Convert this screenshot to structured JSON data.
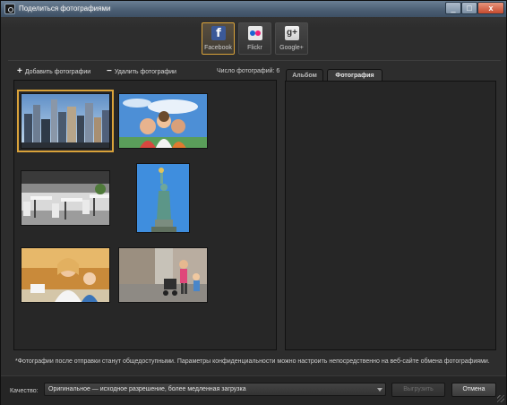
{
  "window": {
    "title": "Поделиться фотографиями",
    "controls": {
      "minimize": "_",
      "maximize": "□",
      "close": "x"
    }
  },
  "services": [
    {
      "name": "Facebook",
      "icon": "facebook-icon",
      "active": true,
      "logo_text": "f"
    },
    {
      "name": "Flickr",
      "icon": "flickr-icon",
      "active": false,
      "logo_text": ""
    },
    {
      "name": "Google+",
      "icon": "google-plus-icon",
      "active": false,
      "logo_text": "g+"
    }
  ],
  "actions": {
    "add_label": "Добавить фотографии",
    "remove_label": "Удалить фотографии",
    "count_label": "Число фотографий: 6"
  },
  "photos": [
    {
      "subject": "city-skyline-thumbnail",
      "selected": true
    },
    {
      "subject": "group-selfie-thumbnail",
      "selected": false
    },
    {
      "subject": "cafe-tables-thumbnail",
      "selected": false
    },
    {
      "subject": "statue-of-liberty-thumbnail",
      "selected": false
    },
    {
      "subject": "mother-and-child-thumbnail",
      "selected": false
    },
    {
      "subject": "street-stroller-thumbnail",
      "selected": false
    }
  ],
  "tabs": {
    "album": "Альбом",
    "photo": "Фотография",
    "active": "photo"
  },
  "notice": "*Фотографии после отправки станут общедоступными. Параметры конфиденциальности можно настроить непосредственно на веб-сайте обмена фотографиями.",
  "quality": {
    "label": "Качество:",
    "value": "Оригинальное — исходное разрешение, более медленная загрузка"
  },
  "buttons": {
    "upload": "Выгрузить",
    "cancel": "Отмена"
  },
  "colors": {
    "accent": "#d9a23a",
    "facebook": "#3b5998",
    "background": "#2d2d2d"
  }
}
